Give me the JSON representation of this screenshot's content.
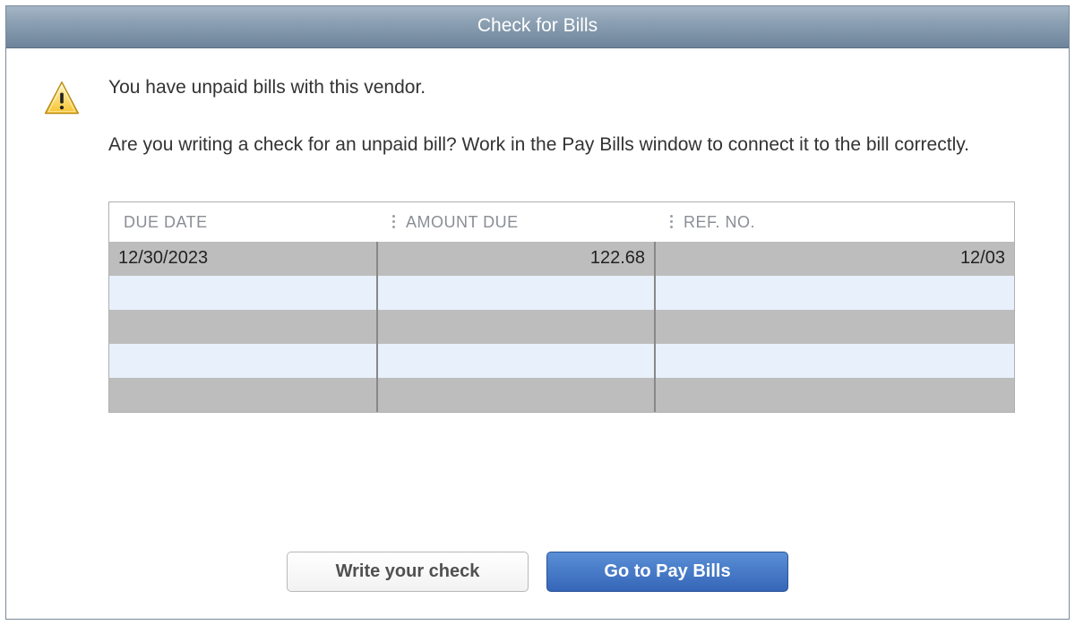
{
  "dialog": {
    "title": "Check for Bills",
    "message1": "You have unpaid bills with this vendor.",
    "message2": "Are you writing a check for an unpaid bill? Work in the Pay Bills window to connect it to the bill correctly."
  },
  "table": {
    "headers": {
      "due_date": "DUE DATE",
      "amount_due": "AMOUNT DUE",
      "ref_no": "REF. NO."
    },
    "rows": [
      {
        "due_date": "12/30/2023",
        "amount_due": "122.68",
        "ref_no": "12/03"
      },
      {
        "due_date": "",
        "amount_due": "",
        "ref_no": ""
      },
      {
        "due_date": "",
        "amount_due": "",
        "ref_no": ""
      },
      {
        "due_date": "",
        "amount_due": "",
        "ref_no": ""
      },
      {
        "due_date": "",
        "amount_due": "",
        "ref_no": ""
      }
    ]
  },
  "buttons": {
    "write_check": "Write your check",
    "go_to_pay_bills": "Go to Pay Bills"
  }
}
